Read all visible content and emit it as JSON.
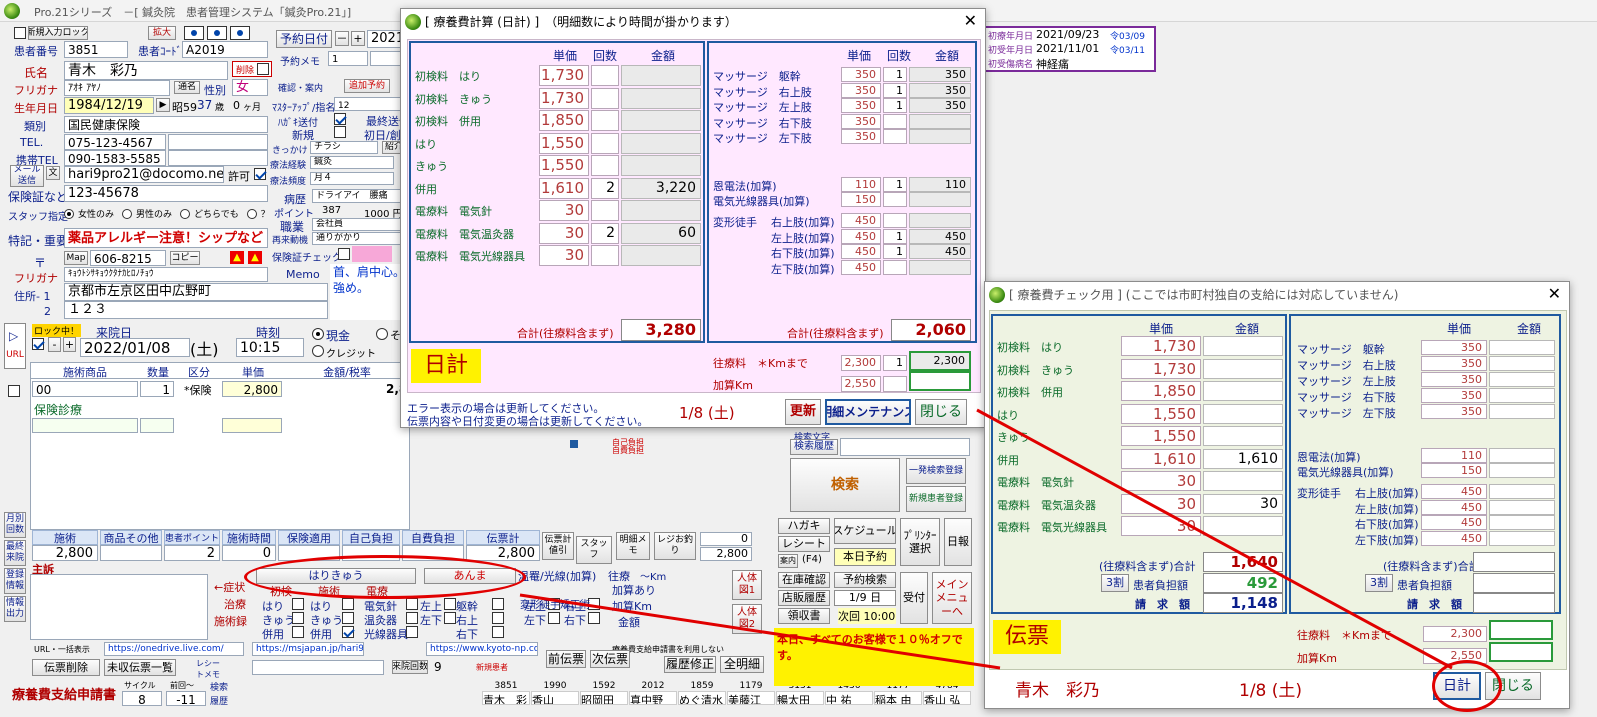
{
  "main": {
    "title": "Pro.21シリーズ　－[ 鍼灸院　患者管理システム「鍼灸Pro.21」]",
    "new_entry_lock": "新規入力ロック",
    "patient_no_label": "患者番号",
    "patient_no": "3851",
    "expand": "拡大",
    "patient_code_label": "患者ｺｰﾄﾞ",
    "patient_code": "A2019",
    "name_label": "氏名",
    "name": "青木　彩乃",
    "delete_label": "削除",
    "kana_label": "フリガナ",
    "kana": "ｱｵｷ ｱﾔﾉ",
    "alias": "通名",
    "sex_label": "性別",
    "sex": "女",
    "birth_label": "生年月日",
    "birth": "1984/12/19",
    "era": "昭59",
    "age": "37",
    "age_unit": "歳",
    "months": "0",
    "months_unit": "ヶ月",
    "type_label": "類別",
    "type": "国民健康保険",
    "tel_label": "TEL.",
    "tel": "075-123-4567",
    "mobile_label": "携帯TEL",
    "mobile": "090-1583-5585",
    "mail_label": "メール送信",
    "mail_char": "文",
    "mail": "hari9pro21@docomo.ne.jp",
    "permit": "許可",
    "insurance_label": "保険証など",
    "insurance": "123-45678",
    "staff_label": "スタッフ指定",
    "staff_opt1": "女性のみ",
    "staff_opt2": "男性のみ",
    "staff_opt3": "どちらでも",
    "staff_q": "？",
    "special_label": "特記・重要",
    "special": "薬品アレルギー注意！シップなど",
    "zip_mark": "〒",
    "map": "Map",
    "zip": "606-8215",
    "copy": "コピー",
    "addr_kana_label": "フリガナ",
    "addr_kana": "ｷｮｳﾄｼｻｷｮｳｸﾀﾅｶﾋﾛﾉﾁｮｳ",
    "memo_label": "Memo",
    "memo": "首、肩中心。\n強め。",
    "addr1_label": "住所- 1",
    "addr1": "京都市左京区田中広野町",
    "addr2_label": "2",
    "addr2": "１２３",
    "appt_btn": "予約日付",
    "appt_minus": "－",
    "appt_plus": "+",
    "appt_date": "2021/",
    "appt_memo_label": "予約メモ",
    "appt_memo_val": "1",
    "appt_info": "確認・案内",
    "additional": "追加予約",
    "master_label": "ﾏｽﾀｰｱｯﾌﾟ/指名",
    "master_val": "12",
    "postcard_label": "ﾊｶﾞｷ送付",
    "last_send": "最終送信",
    "new_label": "新規",
    "first_label": "初日/創",
    "trigger_label": "きっかけ",
    "trigger": "チラシ",
    "intro": "紹介",
    "treat_hist_label": "療法経験",
    "treat_hist": "鍼灸",
    "treat_freq_label": "療法頻度",
    "treat_freq": "月４",
    "disease_label": "病歴",
    "disease": "ドライアイ　腰痛",
    "point_label": "ポイント",
    "point": "387",
    "point_yen": "1000 円",
    "job_label": "職業",
    "job": "会社員",
    "revisit_label": "再来動機",
    "revisit": "通りがかり",
    "ins_check_label": "保険証チェック",
    "last_label": "ロック中！",
    "visit_label": "来院日",
    "visit_date": "2022/01/08",
    "visit_dow": "(土)",
    "time_label": "時刻",
    "time": "10:15",
    "cash": "現金",
    "credit": "クレジット",
    "other": "その",
    "url_btn": "URL",
    "items_hdr": [
      "施術商品",
      "数量",
      "区分",
      "単価",
      "金額/税率"
    ],
    "row1": {
      "code": "00",
      "qty": "1",
      "kind": "*保険",
      "price": "2,800",
      "amount": "2,8"
    },
    "row2": "保険診療",
    "sum_hdr": [
      "施術",
      "商品その他",
      "患者ポイント",
      "施術時間",
      "保険適用",
      "自己負担",
      "自費負担",
      "伝票計"
    ],
    "sum_vals": [
      "2,800",
      "",
      "2",
      "0",
      "",
      "",
      "",
      "2,800"
    ],
    "slip_calc": "伝票計値引",
    "staff_btn": "スタッフ",
    "detail_memo": "明細メモ",
    "register": "レジお釣り",
    "reg_val1": "0",
    "reg_val2": "2,800",
    "main_label": "主訴",
    "symptom": "←症状",
    "cure": "治療",
    "record": "施術録",
    "therapy_tab1": "はりきゅう",
    "therapy_tab2": "あんま",
    "cols": [
      "初検",
      "施術",
      "電療"
    ],
    "c1": [
      "はり",
      "きゅう",
      "併用"
    ],
    "c2": [
      "はり",
      "きゅう",
      "併用"
    ],
    "c3": [
      "電気針",
      "温灸器",
      "光線器具"
    ],
    "c4": [
      "左上",
      "左下"
    ],
    "c5": [
      "躯幹",
      "右上",
      "右下"
    ],
    "warm": "温罨/光線(加算)",
    "deform": "変形徒手矯正術",
    "c6": [
      "左上",
      "左下"
    ],
    "c7": [
      "右上",
      "右下"
    ],
    "ojo": "往療",
    "ojo_km": "～Km",
    "ojo_add": "加算あり",
    "add_km": "加算Km",
    "amount_lbl": "金額",
    "body1": "人体図1",
    "body2": "人体図2",
    "url_sel": "URL・一括表示",
    "url1": "https://onedrive.live.com/",
    "url2": "https://msjapan.jp/hari9p",
    "url3": "https://www.kyoto-np.co.",
    "receipt_app": "療養費支給申請書を利用しない",
    "slip_del": "伝票削除",
    "unrec": "未収伝票一覧",
    "receipt_memo": "レシートメモ",
    "visit_count_label": "来院回数",
    "visit_count": "9",
    "new_patient": "新規患者",
    "prev_slip": "前伝票",
    "next_slip": "次伝票",
    "hist_fix": "履歴修正",
    "all_detail": "全明細",
    "app_btn": "療養費支給申請書",
    "cycle_label": "サイクル",
    "prev_label": "前回～",
    "cycle": "8",
    "prev": "-11",
    "search_label": "検索",
    "history_label": "履歴",
    "left_menu": [
      "月別回数",
      "最終来院",
      "登録情報",
      "情報出力"
    ],
    "right": {
      "keyword": "検索文字",
      "hist": "検索履歴",
      "search": "検索",
      "quick_search": "一発検索登録",
      "new_reg": "新規患者登録",
      "postcard": "ハガキ",
      "receipt": "レシート",
      "guide": "案内",
      "f4": "(F4)",
      "schedule": "スケジュール",
      "today_appt": "本日予約",
      "printer": "ﾌﾟﾘﾝﾀｰ選択",
      "daily": "日報",
      "stock": "在庫確認",
      "store": "店販履歴",
      "receipt_book": "領収書",
      "appt_search": "予約検索",
      "appt_day": "1/9 日",
      "next_time": "次回 10:00",
      "reception": "受付",
      "menu": "メインメニューへ",
      "ad": "本日、すべてのお客様で１０％オフです。",
      "deposit": "自己負担",
      "self": "自費負担",
      "cnt_red": "伝票"
    },
    "patients": [
      {
        "no": "3851",
        "name": "青木　彩"
      },
      {
        "no": "1990",
        "name": "香山"
      },
      {
        "no": "1592",
        "name": "昭岡田"
      },
      {
        "no": "2012",
        "name": "真中野"
      },
      {
        "no": "1859",
        "name": "めぐ清水"
      },
      {
        "no": "1179",
        "name": "美藤江"
      },
      {
        "no": "3131",
        "name": "暢太田"
      },
      {
        "no": "1436",
        "name": "中 祐"
      },
      {
        "no": "1177",
        "name": "稲本 由"
      },
      {
        "no": "4784",
        "name": "香山 弘"
      }
    ],
    "init_panel": [
      {
        "label": "初療年月日",
        "date": "2021/09/23",
        "era": "令03/09"
      },
      {
        "label": "初受年月日",
        "date": "2021/11/01",
        "era": "令03/11"
      },
      {
        "label": "初受傷病名",
        "date": "神経痛",
        "era": ""
      }
    ]
  },
  "daily": {
    "title": "[ 療養費計算 (日計) ]　（明細数により時間が掛かります）",
    "close_x": "✕",
    "left_headers": [
      "単価",
      "回数",
      "金額"
    ],
    "left_rows": [
      {
        "name": "初検料　はり",
        "price": "1,730",
        "cnt": "",
        "amt": ""
      },
      {
        "name": "初検料　きゅう",
        "price": "1,730",
        "cnt": "",
        "amt": ""
      },
      {
        "name": "初検料　併用",
        "price": "1,850",
        "cnt": "",
        "amt": ""
      },
      {
        "name": "はり",
        "price": "1,550",
        "cnt": "",
        "amt": ""
      },
      {
        "name": "きゅう",
        "price": "1,550",
        "cnt": "",
        "amt": ""
      },
      {
        "name": "併用",
        "price": "1,610",
        "cnt": "2",
        "amt": "3,220"
      },
      {
        "name": "電療料　電気針",
        "price": "30",
        "cnt": "",
        "amt": ""
      },
      {
        "name": "電療料　電気温灸器",
        "price": "30",
        "cnt": "2",
        "amt": "60"
      },
      {
        "name": "電療料　電気光線器具",
        "price": "30",
        "cnt": "",
        "amt": ""
      }
    ],
    "left_total_label": "合計(往療料含まず)",
    "left_total": "3,280",
    "right_headers": [
      "単価",
      "回数",
      "金額"
    ],
    "right_rows": [
      {
        "name": "マッサージ　躯幹",
        "price": "350",
        "cnt": "1",
        "amt": "350"
      },
      {
        "name": "マッサージ　右上肢",
        "price": "350",
        "cnt": "1",
        "amt": "350"
      },
      {
        "name": "マッサージ　左上肢",
        "price": "350",
        "cnt": "1",
        "amt": "350"
      },
      {
        "name": "マッサージ　右下肢",
        "price": "350",
        "cnt": "",
        "amt": ""
      },
      {
        "name": "マッサージ　左下肢",
        "price": "350",
        "cnt": "",
        "amt": ""
      }
    ],
    "right_rows2": [
      {
        "name": "恩電法(加算)",
        "price": "110",
        "cnt": "1",
        "amt": "110"
      },
      {
        "name": "電気光線器具(加算)",
        "price": "150",
        "cnt": "",
        "amt": ""
      }
    ],
    "deform_label": "変形徒手",
    "right_rows3": [
      {
        "name": "右上肢(加算)",
        "price": "450",
        "cnt": "",
        "amt": ""
      },
      {
        "name": "左上肢(加算)",
        "price": "450",
        "cnt": "1",
        "amt": "450"
      },
      {
        "name": "右下肢(加算)",
        "price": "450",
        "cnt": "1",
        "amt": "450"
      },
      {
        "name": "左下肢(加算)",
        "price": "450",
        "cnt": "",
        "amt": ""
      }
    ],
    "right_total_label": "合計(往療料含まず)",
    "right_total": "2,060",
    "nikkei": "日計",
    "ojo_label": "往療料　＊Kmまで",
    "ojo_price": "2,300",
    "ojo_cnt": "1",
    "ojo_amt": "2,300",
    "addkm_label": "加算Km",
    "addkm_price": "2,550",
    "msg1": "エラー表示の場合は更新してください。",
    "msg2": "伝票内容や日付変更の場合は更新してください。",
    "date": "1/8 (土)",
    "refresh": "更新",
    "maint": "明細メンテナンス",
    "close": "閉じる"
  },
  "check": {
    "title": "[ 療養費チェック用 ] (ここでは市町村独自の支給には対応していません)",
    "close_x": "✕",
    "left_headers": [
      "単価",
      "金額"
    ],
    "left_rows": [
      {
        "name": "初検料　はり",
        "price": "1,730",
        "amt": ""
      },
      {
        "name": "初検料　きゅう",
        "price": "1,730",
        "amt": ""
      },
      {
        "name": "初検料　併用",
        "price": "1,850",
        "amt": ""
      },
      {
        "name": "はり",
        "price": "1,550",
        "amt": ""
      },
      {
        "name": "きゅう",
        "price": "1,550",
        "amt": ""
      },
      {
        "name": "併用",
        "price": "1,610",
        "amt": "1,610"
      },
      {
        "name": "電療料　電気針",
        "price": "30",
        "amt": ""
      },
      {
        "name": "電療料　電気温灸器",
        "price": "30",
        "amt": "30"
      },
      {
        "name": "電療料　電気光線器具",
        "price": "30",
        "amt": ""
      }
    ],
    "left_total_label": "(往療料含まず)合計",
    "left_total": "1,640",
    "ratio": "3割",
    "burden_label": "患者負担額",
    "burden": "492",
    "claim_label": "請　求　額",
    "claim": "1,148",
    "right_headers": [
      "単価",
      "金額"
    ],
    "right_rows": [
      {
        "name": "マッサージ　躯幹",
        "price": "350"
      },
      {
        "name": "マッサージ　右上肢",
        "price": "350"
      },
      {
        "name": "マッサージ　左上肢",
        "price": "350"
      },
      {
        "name": "マッサージ　右下肢",
        "price": "350"
      },
      {
        "name": "マッサージ　左下肢",
        "price": "350"
      }
    ],
    "right_rows2": [
      {
        "name": "恩電法(加算)",
        "price": "110"
      },
      {
        "name": "電気光線器具(加算)",
        "price": "150"
      }
    ],
    "deform_label": "変形徒手",
    "right_rows3": [
      {
        "name": "右上肢(加算)",
        "price": "450"
      },
      {
        "name": "左上肢(加算)",
        "price": "450"
      },
      {
        "name": "右下肢(加算)",
        "price": "450"
      },
      {
        "name": "左下肢(加算)",
        "price": "450"
      }
    ],
    "right_total_label": "(往療料含まず)合計",
    "right_ratio": "3割",
    "right_burden_label": "患者負担額",
    "right_claim_label": "請　求　額",
    "denpyo": "伝票",
    "ojo_label": "往療料　＊Kmまで",
    "ojo_price": "2,300",
    "addkm_label": "加算Km",
    "addkm_price": "2,550",
    "patient": "青木　彩乃",
    "date": "1/8 (土)",
    "nikkei_btn": "日計",
    "close": "閉じる"
  }
}
